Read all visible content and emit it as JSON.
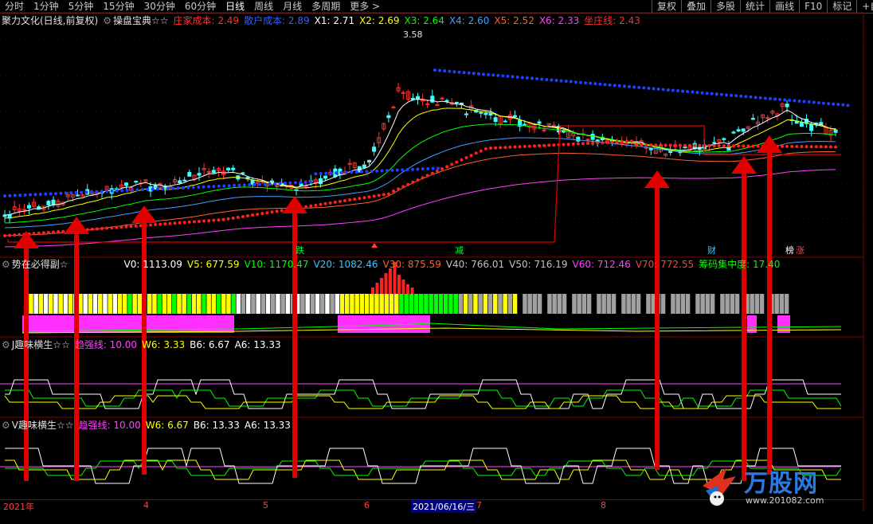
{
  "toolbar": {
    "periods": [
      "分时",
      "1分钟",
      "5分钟",
      "15分钟",
      "30分钟",
      "60分钟",
      "日线",
      "周线",
      "月线",
      "多周期",
      "更多 >"
    ],
    "active_period": "日线",
    "right_buttons": [
      "复权",
      "叠加",
      "多股",
      "统计",
      "画线",
      "F10",
      "标记",
      "+自选"
    ]
  },
  "main_panel": {
    "title": "聚力文化(日线,前复权)",
    "indicator": "操盘宝典",
    "stars": "☆☆",
    "values": [
      {
        "label": "庄家成本:",
        "value": "2.49",
        "color": "#ff3030"
      },
      {
        "label": "散户成本:",
        "value": "2.89",
        "color": "#3060ff"
      },
      {
        "label": "X1:",
        "value": "2.71",
        "color": "#ffffff"
      },
      {
        "label": "X2:",
        "value": "2.69",
        "color": "#ffff00"
      },
      {
        "label": "X3:",
        "value": "2.64",
        "color": "#00ff00"
      },
      {
        "label": "X4:",
        "value": "2.60",
        "color": "#40a0ff"
      },
      {
        "label": "X5:",
        "value": "2.52",
        "color": "#ff6030"
      },
      {
        "label": "X6:",
        "value": "2.33",
        "color": "#ff40ff"
      },
      {
        "label": "坐庄线:",
        "value": "2.43",
        "color": "#ff3030"
      }
    ],
    "peak_label": "3.58",
    "signal_labels": [
      {
        "text": "跌",
        "color": "#00ff40"
      },
      {
        "text": "减",
        "color": "#00ff40"
      },
      {
        "text": "财",
        "color": "#40c0ff"
      },
      {
        "text": "榜",
        "color": "#ffffff"
      },
      {
        "text": "涨",
        "color": "#ff4040"
      }
    ]
  },
  "volume_panel": {
    "title": "势在必得副☆",
    "values": [
      {
        "label": "V0:",
        "value": "1113.09",
        "color": "#ffffff"
      },
      {
        "label": "V5:",
        "value": "677.59",
        "color": "#ffff00"
      },
      {
        "label": "V10:",
        "value": "1170.47",
        "color": "#00ff00"
      },
      {
        "label": "V20:",
        "value": "1082.46",
        "color": "#40c0ff"
      },
      {
        "label": "V30:",
        "value": "875.59",
        "color": "#ff6030"
      },
      {
        "label": "V40:",
        "value": "766.01",
        "color": "#c0c0c0"
      },
      {
        "label": "V50:",
        "value": "716.19",
        "color": "#c0c0c0"
      },
      {
        "label": "V60:",
        "value": "712.46",
        "color": "#ff40ff"
      },
      {
        "label": "V70:",
        "value": "772.55",
        "color": "#ff4040"
      },
      {
        "label": "筹码集中度:",
        "value": "17.40",
        "color": "#00ff00"
      }
    ]
  },
  "j_panel": {
    "title": "J趣味横生☆☆",
    "values": [
      {
        "label": "趋强线:",
        "value": "10.00",
        "color": "#ff40ff"
      },
      {
        "label": "W6:",
        "value": "3.33",
        "color": "#ffff00"
      },
      {
        "label": "B6:",
        "value": "6.67",
        "color": "#ffffff"
      },
      {
        "label": "A6:",
        "value": "13.33",
        "color": "#ffffff"
      }
    ]
  },
  "v_panel": {
    "title": "V趣味横生☆☆",
    "values": [
      {
        "label": "趋强线:",
        "value": "10.00",
        "color": "#ff40ff"
      },
      {
        "label": "W6:",
        "value": "6.67",
        "color": "#ffff00"
      },
      {
        "label": "B6:",
        "value": "13.33",
        "color": "#ffffff"
      },
      {
        "label": "A6:",
        "value": "13.33",
        "color": "#ffffff"
      }
    ]
  },
  "date_axis": {
    "labels": [
      "2021年",
      "4",
      "5",
      "6",
      "2021/06/16/三",
      "7",
      "8"
    ]
  },
  "watermark": {
    "brand": "万股网",
    "url": "www.201082.com"
  }
}
